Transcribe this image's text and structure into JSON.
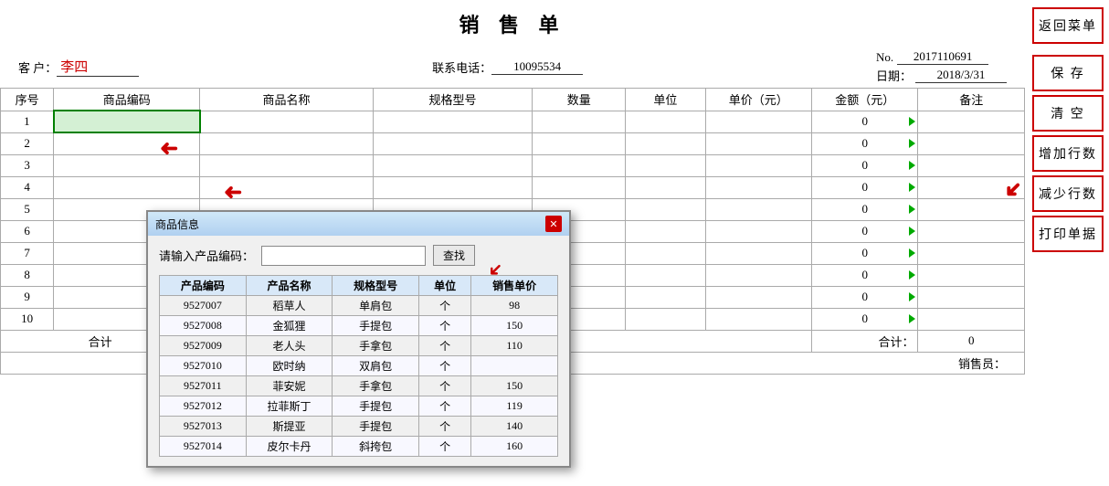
{
  "title": "销  售  单",
  "header": {
    "customer_label": "客  户：",
    "customer_value": "李四",
    "phone_label": "联系电话：",
    "phone_value": "10095534",
    "date_label": "日期：",
    "date_value": "2018/3/31",
    "no_label": "No.",
    "no_value": "2017110691"
  },
  "table": {
    "headers": [
      "序号",
      "商品编码",
      "商品名称",
      "规格型号",
      "数量",
      "单位",
      "单价（元）",
      "金额（元）",
      "备注"
    ],
    "rows": [
      {
        "seq": "1",
        "code": "",
        "name": "",
        "spec": "",
        "qty": "",
        "unit": "",
        "price": "",
        "amount": "0",
        "note": ""
      },
      {
        "seq": "2",
        "code": "",
        "name": "",
        "spec": "",
        "qty": "",
        "unit": "",
        "price": "",
        "amount": "0",
        "note": ""
      },
      {
        "seq": "3",
        "code": "",
        "name": "",
        "spec": "",
        "qty": "",
        "unit": "",
        "price": "",
        "amount": "0",
        "note": ""
      },
      {
        "seq": "4",
        "code": "",
        "name": "",
        "spec": "",
        "qty": "",
        "unit": "",
        "price": "",
        "amount": "0",
        "note": ""
      },
      {
        "seq": "5",
        "code": "",
        "name": "",
        "spec": "",
        "qty": "",
        "unit": "",
        "price": "",
        "amount": "0",
        "note": ""
      },
      {
        "seq": "6",
        "code": "",
        "name": "",
        "spec": "",
        "qty": "",
        "unit": "",
        "price": "",
        "amount": "0",
        "note": ""
      },
      {
        "seq": "7",
        "code": "",
        "name": "",
        "spec": "",
        "qty": "",
        "unit": "",
        "price": "",
        "amount": "0",
        "note": ""
      },
      {
        "seq": "8",
        "code": "",
        "name": "",
        "spec": "",
        "qty": "",
        "unit": "",
        "price": "",
        "amount": "0",
        "note": ""
      },
      {
        "seq": "9",
        "code": "",
        "name": "",
        "spec": "",
        "qty": "",
        "unit": "",
        "price": "",
        "amount": "0",
        "note": ""
      },
      {
        "seq": "10",
        "code": "",
        "name": "",
        "spec": "",
        "qty": "",
        "unit": "",
        "price": "",
        "amount": "0",
        "note": ""
      }
    ],
    "footer": {
      "label": "合计",
      "total_label": "合计：",
      "total_value": "0",
      "salesperson_label": "销售员："
    }
  },
  "buttons": {
    "back": "返回菜单",
    "save": "保  存",
    "clear": "清  空",
    "add_row": "增加行数",
    "remove_row": "减少行数",
    "print": "打印单据"
  },
  "dialog": {
    "title": "商品信息",
    "search_label": "请输入产品编码：",
    "search_placeholder": "",
    "search_btn": "查找",
    "table_headers": [
      "产品编码",
      "产品名称",
      "规格型号",
      "单位",
      "销售单价"
    ],
    "rows": [
      {
        "code": "9527007",
        "name": "稻草人",
        "spec": "单肩包",
        "unit": "个",
        "price": "98"
      },
      {
        "code": "9527008",
        "name": "金狐狸",
        "spec": "手提包",
        "unit": "个",
        "price": "150"
      },
      {
        "code": "9527009",
        "name": "老人头",
        "spec": "手拿包",
        "unit": "个",
        "price": "110"
      },
      {
        "code": "9527010",
        "name": "欧时纳",
        "spec": "双肩包",
        "unit": "个",
        "price": ""
      },
      {
        "code": "9527011",
        "name": "菲安妮",
        "spec": "手拿包",
        "unit": "个",
        "price": "150"
      },
      {
        "code": "9527012",
        "name": "拉菲斯丁",
        "spec": "手提包",
        "unit": "个",
        "price": "119"
      },
      {
        "code": "9527013",
        "name": "斯提亚",
        "spec": "手提包",
        "unit": "个",
        "price": "140"
      },
      {
        "code": "9527014",
        "name": "皮尔卡丹",
        "spec": "斜挎包",
        "unit": "个",
        "price": "160"
      }
    ]
  }
}
